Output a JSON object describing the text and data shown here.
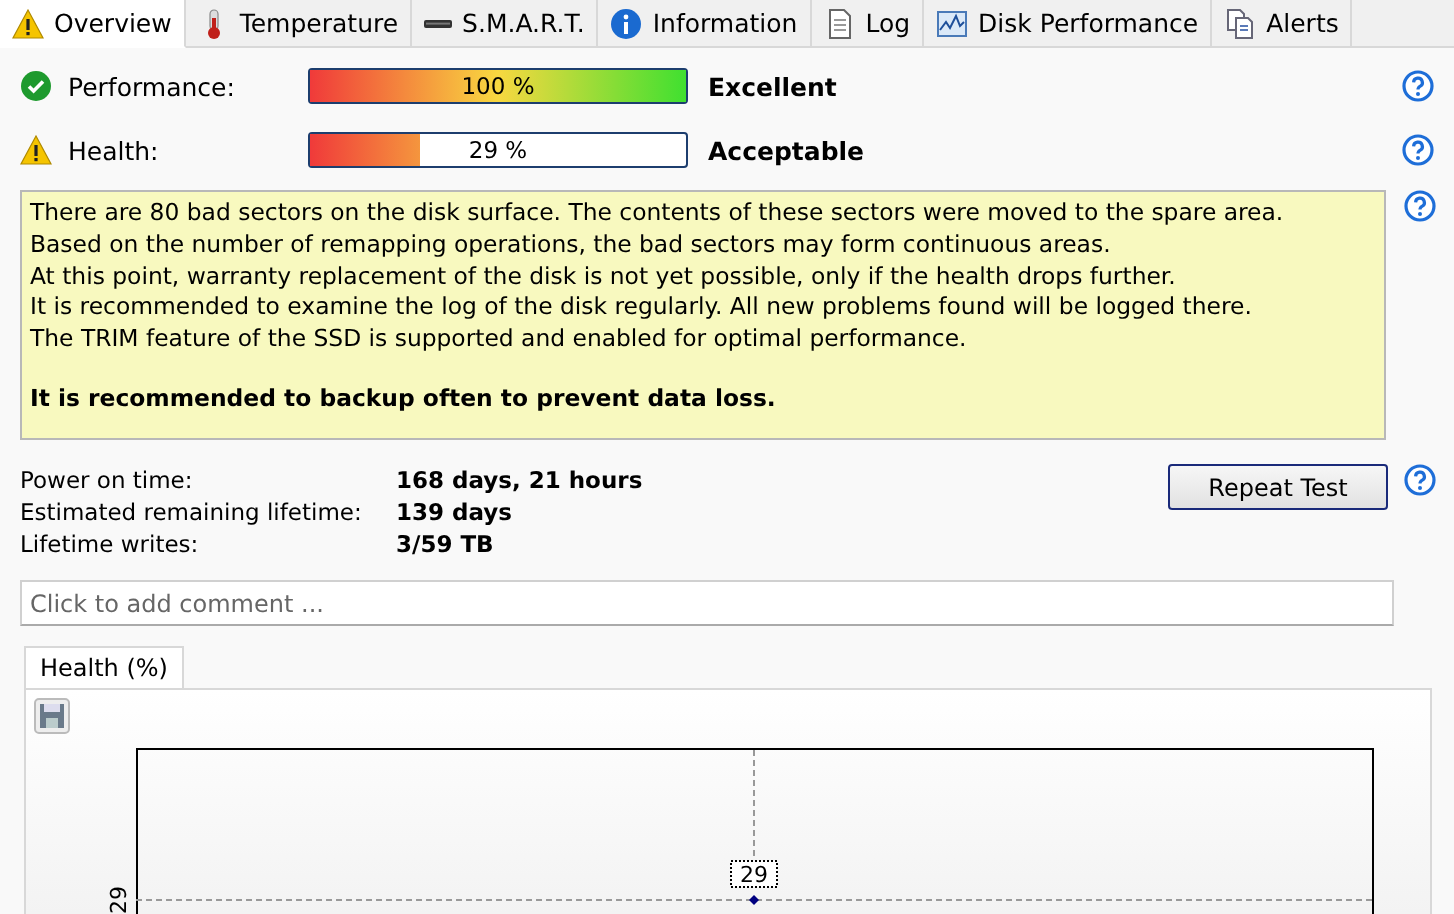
{
  "tabs": [
    {
      "label": "Overview",
      "kind": "warning",
      "selected": true
    },
    {
      "label": "Temperature",
      "kind": "thermometer",
      "selected": false
    },
    {
      "label": "S.M.A.R.T.",
      "kind": "drive",
      "selected": false
    },
    {
      "label": "Information",
      "kind": "info",
      "selected": false
    },
    {
      "label": "Log",
      "kind": "document",
      "selected": false
    },
    {
      "label": "Disk Performance",
      "kind": "graph",
      "selected": false
    },
    {
      "label": "Alerts",
      "kind": "documents",
      "selected": false
    }
  ],
  "meters": [
    {
      "label": "Performance:",
      "kind": "ok",
      "level": 1.0,
      "reading": "100 %",
      "rating": "Excellent"
    },
    {
      "label": "Health:",
      "kind": "warning",
      "level": 0.29,
      "reading": "29 %",
      "rating": "Acceptable"
    }
  ],
  "message": [
    {
      "text": "There are 80 bad sectors on the disk surface. The contents of these sectors were moved to the spare area.",
      "bold": false
    },
    {
      "text": "Based on the number of remapping operations, the bad sectors may form continuous areas.",
      "bold": false
    },
    {
      "text": "At this point, warranty replacement of the disk is not yet possible, only if the health drops further.",
      "bold": false
    },
    {
      "text": "It is recommended to examine the log of the disk regularly. All new problems found will be logged there.",
      "bold": false
    },
    {
      "text": "The TRIM feature of the SSD is supported and enabled for optimal performance.",
      "bold": false
    },
    {
      "text": "It is recommended to backup often to prevent data loss.",
      "bold": true
    }
  ],
  "stats": [
    {
      "label": "Power on time:",
      "value": "168 days, 21 hours"
    },
    {
      "label": "Estimated remaining lifetime:",
      "value": "139 days"
    },
    {
      "label": "Lifetime writes:",
      "value": "3/59 TB"
    }
  ],
  "repeat_button": "Repeat Test",
  "comment": {
    "placeholder": "Click to add comment ..."
  },
  "chart_tabs": [
    {
      "label": "Health (%)",
      "selected": true
    }
  ],
  "chart": {
    "y_axis_label": "29",
    "point_label": "29"
  }
}
